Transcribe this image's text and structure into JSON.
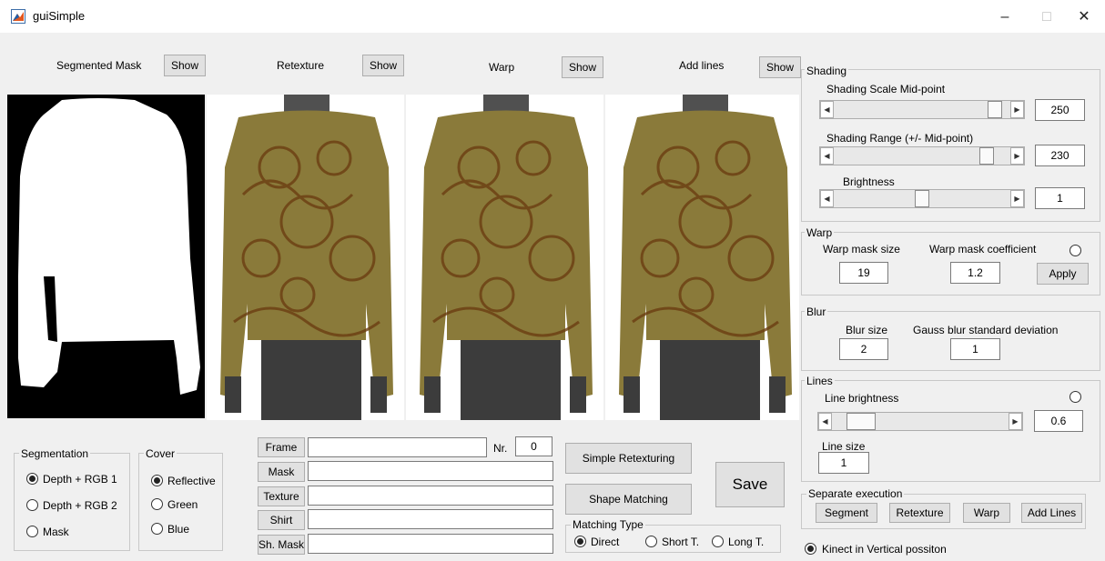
{
  "window": {
    "title": "guiSimple",
    "minimize_glyph": "–",
    "maximize_glyph": "□",
    "close_glyph": "✕"
  },
  "views": [
    {
      "label": "Segmented Mask",
      "show_label": "Show"
    },
    {
      "label": "Retexture",
      "show_label": "Show"
    },
    {
      "label": "Warp",
      "show_label": "Show"
    },
    {
      "label": "Add lines",
      "show_label": "Show"
    }
  ],
  "shading": {
    "title": "Shading",
    "midpoint_label": "Shading Scale Mid-point",
    "midpoint_value": "250",
    "midpoint_slider": 0.95,
    "range_label": "Shading Range (+/- Mid-point)",
    "range_value": "230",
    "range_slider": 0.9,
    "brightness_label": "Brightness",
    "brightness_value": "1",
    "brightness_slider": 0.5
  },
  "warp": {
    "title": "Warp",
    "size_label": "Warp mask size",
    "coef_label": "Warp mask coefficient",
    "size_value": "19",
    "coef_value": "1.2",
    "apply_label": "Apply"
  },
  "blur": {
    "title": "Blur",
    "size_label": "Blur size",
    "dev_label": "Gauss blur standard deviation",
    "size_value": "2",
    "dev_value": "1"
  },
  "lines": {
    "title": "Lines",
    "brightness_label": "Line brightness",
    "brightness_value": "0.6",
    "brightness_slider": 0.1,
    "size_label": "Line size",
    "size_value": "1"
  },
  "separate": {
    "title": "Separate execution",
    "segment": "Segment",
    "retexture": "Retexture",
    "warp": "Warp",
    "add_lines": "Add Lines"
  },
  "kinect_label": "Kinect in Vertical possiton",
  "segmentation": {
    "title": "Segmentation",
    "opt1": "Depth + RGB 1",
    "opt2": "Depth + RGB 2",
    "opt3": "Mask"
  },
  "cover": {
    "title": "Cover",
    "opt1": "Reflective",
    "opt2": "Green",
    "opt3": "Blue"
  },
  "files": {
    "frame": "Frame",
    "mask": "Mask",
    "texture": "Texture",
    "shirt": "Shirt",
    "sh_mask": "Sh. Mask",
    "nr_label": "Nr.",
    "nr_value": "0"
  },
  "actions": {
    "simple": "Simple Retexturing",
    "shape": "Shape Matching",
    "save": "Save"
  },
  "matching": {
    "title": "Matching Type",
    "opt1": "Direct",
    "opt2": "Short T.",
    "opt3": "Long T."
  },
  "colors": {
    "fabric": "#8a7a3a",
    "pattern": "#6b3e12",
    "trousers": "#3c3c3c"
  }
}
